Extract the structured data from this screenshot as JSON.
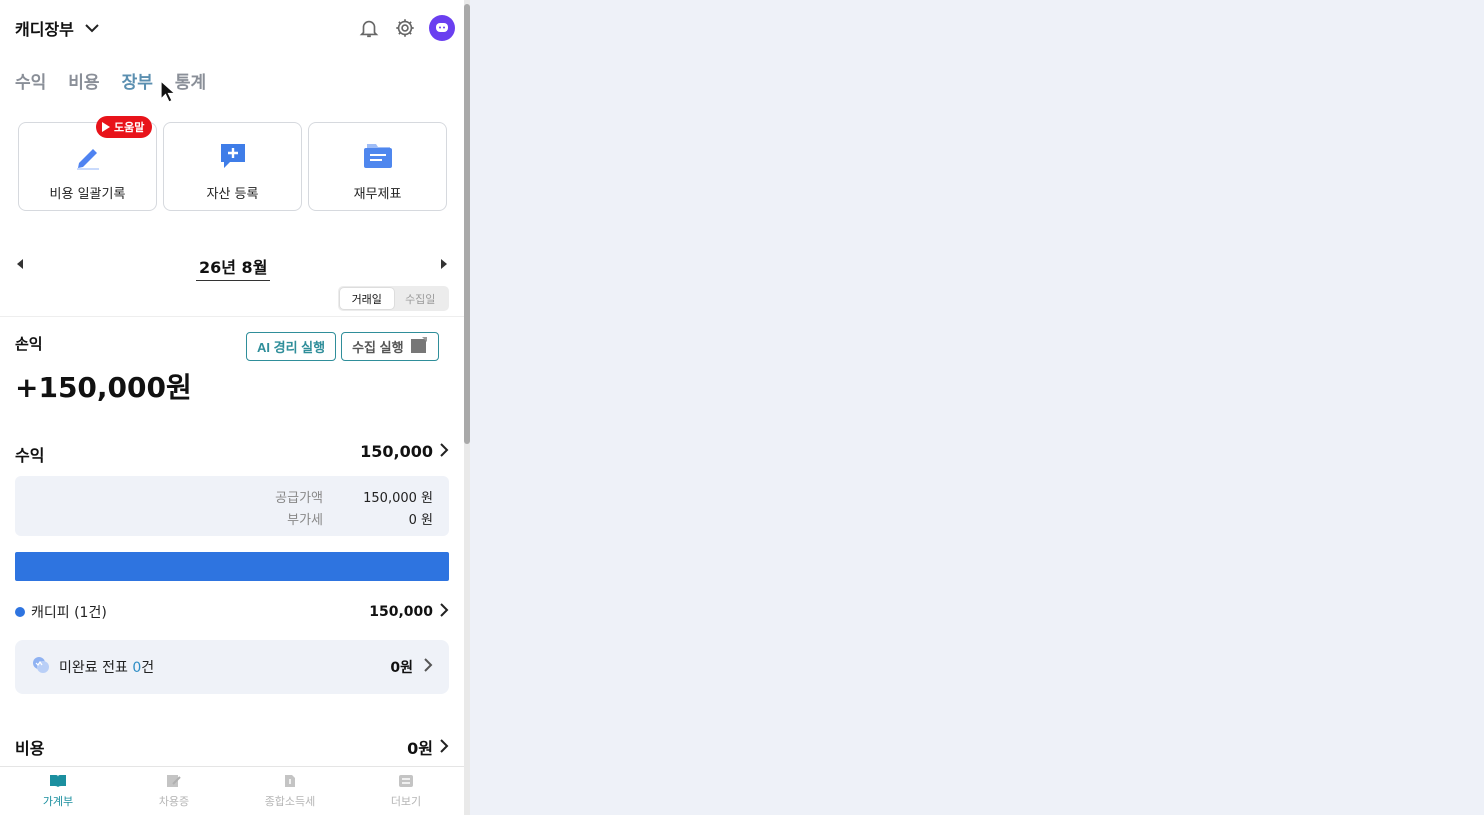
{
  "header": {
    "brand": "캐디장부"
  },
  "tabs": [
    {
      "label": "수익"
    },
    {
      "label": "비용"
    },
    {
      "label": "장부",
      "active": true
    },
    {
      "label": "통계"
    }
  ],
  "actions": [
    {
      "label": "비용 일괄기록",
      "icon": "pencil-icon"
    },
    {
      "label": "자산 등록",
      "icon": "chat-plus-icon"
    },
    {
      "label": "재무제표",
      "icon": "folder-icon"
    }
  ],
  "help_badge": "도움말",
  "period": {
    "label": "26년 8월"
  },
  "date_toggle": {
    "options": [
      "거래일",
      "수집일"
    ],
    "selected": "거래일"
  },
  "pl": {
    "title": "손익",
    "amount": "+150,000원",
    "ai_button": "AI 경리 실행",
    "collect_button": "수집 실행"
  },
  "income": {
    "title": "수익",
    "total": "150,000",
    "supply_label": "공급가액",
    "supply_value": "150,000 원",
    "vat_label": "부가세",
    "vat_value": "0 원",
    "bar_share": 1.0,
    "breakdown": [
      {
        "label": "캐디피 (1건)",
        "value": "150,000",
        "color": "#2e74e0"
      }
    ]
  },
  "pending": {
    "label": "미완료 전표",
    "count": "0",
    "unit": "건",
    "value": "0원"
  },
  "expense": {
    "title": "비용",
    "total": "0원"
  },
  "bottom_nav": [
    {
      "label": "가계부",
      "icon": "book-icon",
      "active": true
    },
    {
      "label": "차용증",
      "icon": "contract-icon"
    },
    {
      "label": "종합소득세",
      "icon": "tax-doc-icon"
    },
    {
      "label": "더보기",
      "icon": "more-list-icon"
    }
  ],
  "colors": {
    "accent": "#2e74e0",
    "teal": "#1b8f9f",
    "badge_red": "#e8131a",
    "avatar": "#6a3ff0"
  }
}
